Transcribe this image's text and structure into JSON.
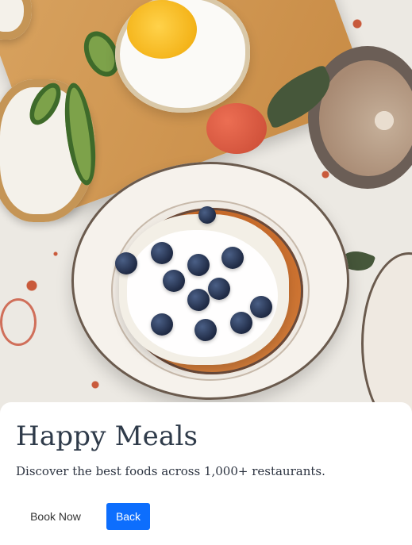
{
  "hero": {
    "image_icon": "breakfast-photo"
  },
  "card": {
    "title": "Happy Meals",
    "subtitle": "Discover the best foods across 1,000+ restaurants.",
    "secondary_button": "Book Now",
    "primary_button": "Back"
  },
  "colors": {
    "title": "#2f3b4a",
    "primary": "#0d6efd",
    "primary_text": "#ffffff"
  }
}
